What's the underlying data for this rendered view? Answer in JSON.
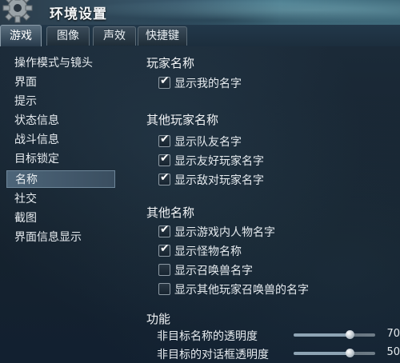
{
  "window": {
    "title": "环境设置"
  },
  "tabs": [
    {
      "label": "游戏",
      "active": true
    },
    {
      "label": "图像",
      "active": false
    },
    {
      "label": "声效",
      "active": false
    },
    {
      "label": "快捷键",
      "active": false
    }
  ],
  "sidebar": {
    "items": [
      {
        "label": "操作模式与镜头"
      },
      {
        "label": "界面"
      },
      {
        "label": "提示"
      },
      {
        "label": "状态信息"
      },
      {
        "label": "战斗信息"
      },
      {
        "label": "目标锁定"
      },
      {
        "label": "名称",
        "selected": true
      },
      {
        "label": "社交"
      },
      {
        "label": "截图"
      },
      {
        "label": "界面信息显示"
      }
    ]
  },
  "sections": {
    "player_name": {
      "title": "玩家名称",
      "options": [
        {
          "label": "显示我的名字",
          "checked": true
        }
      ]
    },
    "other_player_name": {
      "title": "其他玩家名称",
      "options": [
        {
          "label": "显示队友名字",
          "checked": true
        },
        {
          "label": "显示友好玩家名字",
          "checked": true
        },
        {
          "label": "显示敌对玩家名字",
          "checked": true
        }
      ]
    },
    "other_name": {
      "title": "其他名称",
      "options": [
        {
          "label": "显示游戏内人物名字",
          "checked": true
        },
        {
          "label": "显示怪物名称",
          "checked": true
        },
        {
          "label": "显示召唤兽名字",
          "checked": false
        },
        {
          "label": "显示其他玩家召唤兽的名字",
          "checked": false
        }
      ]
    },
    "function": {
      "title": "功能",
      "sliders": [
        {
          "label": "非目标名称的透明度",
          "value": "70",
          "fraction": 0.7
        },
        {
          "label": "非目标的对话框透明度",
          "value": "50",
          "fraction": 0.7
        }
      ]
    }
  },
  "icons": {
    "tick": "✔"
  },
  "colors": {
    "accent": "#8ea4b4",
    "background": "#13202d",
    "selected": "#4d6579"
  }
}
